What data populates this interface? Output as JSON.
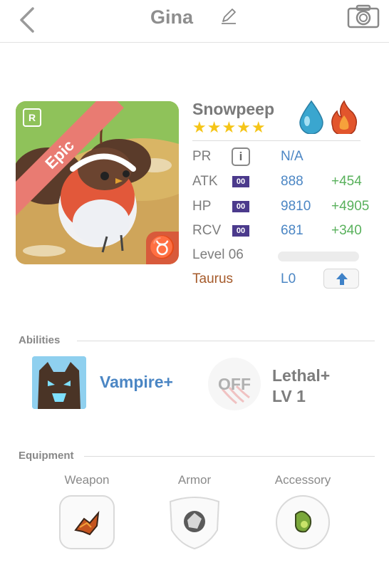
{
  "header": {
    "title": "Gina"
  },
  "card": {
    "rarity": "Epic",
    "rank_badge": "R",
    "zodiac_symbol": "♉"
  },
  "pet": {
    "name": "Snowpeep",
    "stars": "★★★★★",
    "star_count": 5,
    "elements": [
      "water-drop-icon",
      "fire-icon"
    ]
  },
  "stats": {
    "pr": {
      "label": "PR",
      "info": "i",
      "value": "N/A"
    },
    "atk": {
      "label": "ATK",
      "tag": "00",
      "value": "888",
      "bonus": "+454"
    },
    "hp": {
      "label": "HP",
      "tag": "00",
      "value": "9810",
      "bonus": "+4905"
    },
    "rcv": {
      "label": "RCV",
      "tag": "00",
      "value": "681",
      "bonus": "+340"
    },
    "level": {
      "label": "Level 06",
      "progress": 0.0
    },
    "zodiac": {
      "label": "Taurus",
      "value": "L0"
    }
  },
  "abilities": {
    "title": "Abilities",
    "primary": {
      "name": "Vampire+"
    },
    "secondary": {
      "state": "OFF",
      "name_line1": "Lethal+",
      "name_line2": "LV 1"
    }
  },
  "equipment": {
    "title": "Equipment",
    "slots": [
      {
        "label": "Weapon"
      },
      {
        "label": "Armor"
      },
      {
        "label": "Accessory"
      }
    ]
  },
  "colors": {
    "accent_blue": "#4b86c4",
    "bonus_green": "#59b15c",
    "ribbon": "#e97b72",
    "zodiac_brown": "#a55a2a",
    "stat_tag": "#4b3a8c",
    "star": "#f5c518"
  }
}
